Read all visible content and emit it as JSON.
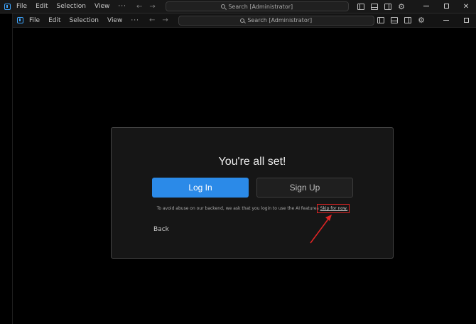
{
  "outer_window": {
    "menu": [
      "File",
      "Edit",
      "Selection",
      "View"
    ],
    "more": "···",
    "back_arrow": "←",
    "forward_arrow": "→",
    "search_text": "Search [Administrator]",
    "gear": "⚙"
  },
  "inner_window": {
    "menu": [
      "File",
      "Edit",
      "Selection",
      "View"
    ],
    "more": "···",
    "back_arrow": "←",
    "forward_arrow": "→",
    "search_text": "Search [Administrator]",
    "gear": "⚙"
  },
  "dialog": {
    "title": "You're all set!",
    "login_label": "Log In",
    "signup_label": "Sign Up",
    "notice_text": "To avoid abuse on our backend, we ask that you login to use the AI features",
    "skip_label": "Skip for now.",
    "back_label": "Back"
  },
  "colors": {
    "accent": "#2b8ae8",
    "annotation": "#e02424"
  }
}
